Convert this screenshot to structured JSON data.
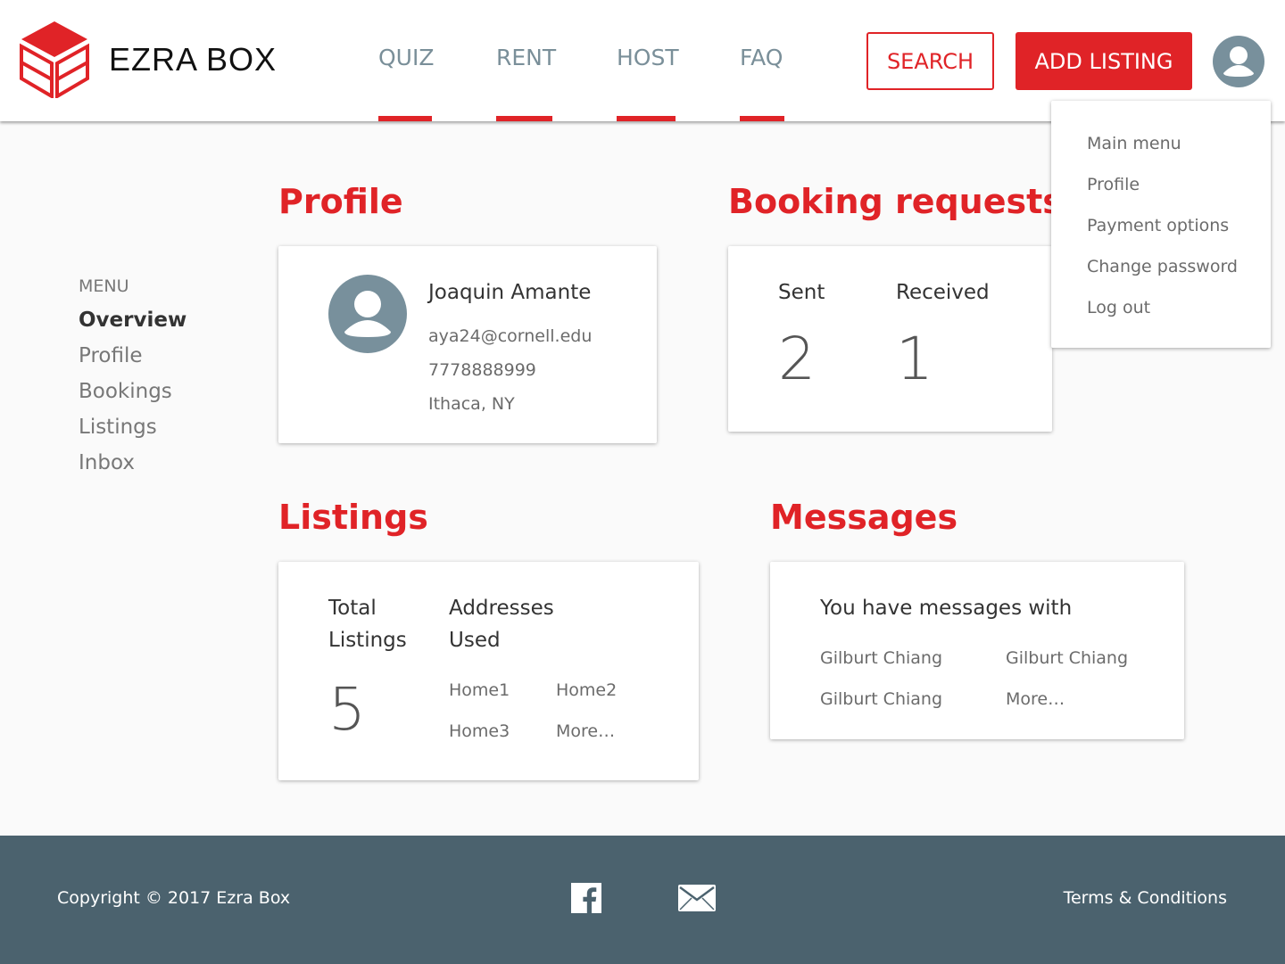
{
  "brand": {
    "name": "EZRA BOX"
  },
  "nav": {
    "quiz": "QUIZ",
    "rent": "RENT",
    "host": "HOST",
    "faq": "FAQ",
    "search_label": "SEARCH",
    "add_listing_label": "ADD LISTING"
  },
  "dropdown": {
    "items": [
      "Main menu",
      "Profile",
      "Payment options",
      "Change password",
      "Log out"
    ]
  },
  "sidebar": {
    "heading": "MENU",
    "items": [
      "Overview",
      "Profile",
      "Bookings",
      "Listings",
      "Inbox"
    ]
  },
  "profile": {
    "title": "Profile",
    "name": "Joaquin Amante",
    "email": "aya24@cornell.edu",
    "phone": "7778888999",
    "location": "Ithaca, NY"
  },
  "bookings": {
    "title": "Booking requests",
    "sent_label": "Sent",
    "sent_count": "2",
    "received_label": "Received",
    "received_count": "1"
  },
  "listings": {
    "title": "Listings",
    "total_label_line1": "Total",
    "total_label_line2": "Listings",
    "total_count": "5",
    "addresses_label_line1": "Addresses",
    "addresses_label_line2": "Used",
    "addresses": [
      "Home1",
      "Home2",
      "Home3",
      "More…"
    ]
  },
  "messages": {
    "title": "Messages",
    "intro": "You have messages with",
    "contacts": [
      "Gilburt Chiang",
      "Gilburt Chiang",
      "Gilburt Chiang",
      "More…"
    ]
  },
  "footer": {
    "copyright": "Copyright © 2017 Ezra Box",
    "terms": "Terms & Conditions"
  },
  "colors": {
    "accent": "#e02327",
    "nav_text": "#7a8f99",
    "footer_bg": "#4b626e",
    "avatar": "#78909c"
  },
  "icons": {
    "logo": "cube-logo-icon",
    "user": "user-avatar-icon",
    "facebook": "facebook-icon",
    "mail": "mail-icon"
  }
}
